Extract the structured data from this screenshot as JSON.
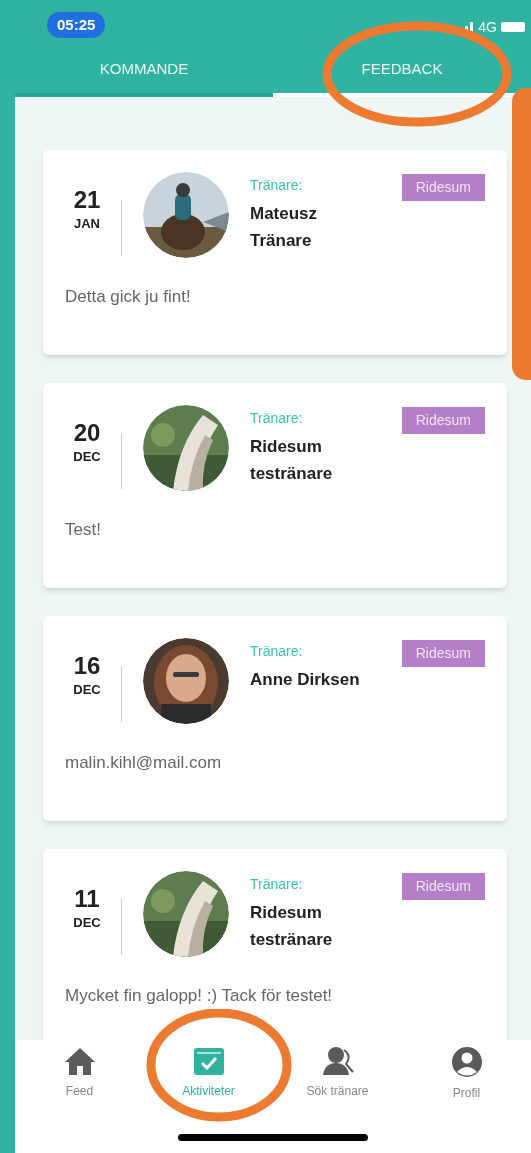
{
  "status_bar": {
    "time": "05:25",
    "network": "4G"
  },
  "tabs": [
    {
      "label": "KOMMANDE",
      "selected": false
    },
    {
      "label": "FEEDBACK",
      "selected": true
    }
  ],
  "cards": [
    {
      "day": "21",
      "month": "JAN",
      "role": "Tränare:",
      "name": "Mateusz Tränare",
      "tag": "Ridesum",
      "message": "Detta gick ju fint!"
    },
    {
      "day": "20",
      "month": "DEC",
      "role": "Tränare:",
      "name": "Ridesum testränare",
      "tag": "Ridesum",
      "message": "Test!"
    },
    {
      "day": "16",
      "month": "DEC",
      "role": "Tränare:",
      "name": "Anne Dirksen",
      "tag": "Ridesum",
      "message": "malin.kihl@mail.com"
    },
    {
      "day": "11",
      "month": "DEC",
      "role": "Tränare:",
      "name": "Ridesum testränare",
      "tag": "Ridesum",
      "message": "Mycket fin galopp! :) Tack för testet!"
    }
  ],
  "bottom_nav": [
    {
      "label": "Feed",
      "selected": false
    },
    {
      "label": "Aktiviteter",
      "selected": true
    },
    {
      "label": "Sök tränare",
      "selected": false
    },
    {
      "label": "Profil",
      "selected": false
    }
  ],
  "annotations": [
    {
      "kind": "ellipse"
    },
    {
      "kind": "box"
    },
    {
      "kind": "ellipse"
    }
  ]
}
